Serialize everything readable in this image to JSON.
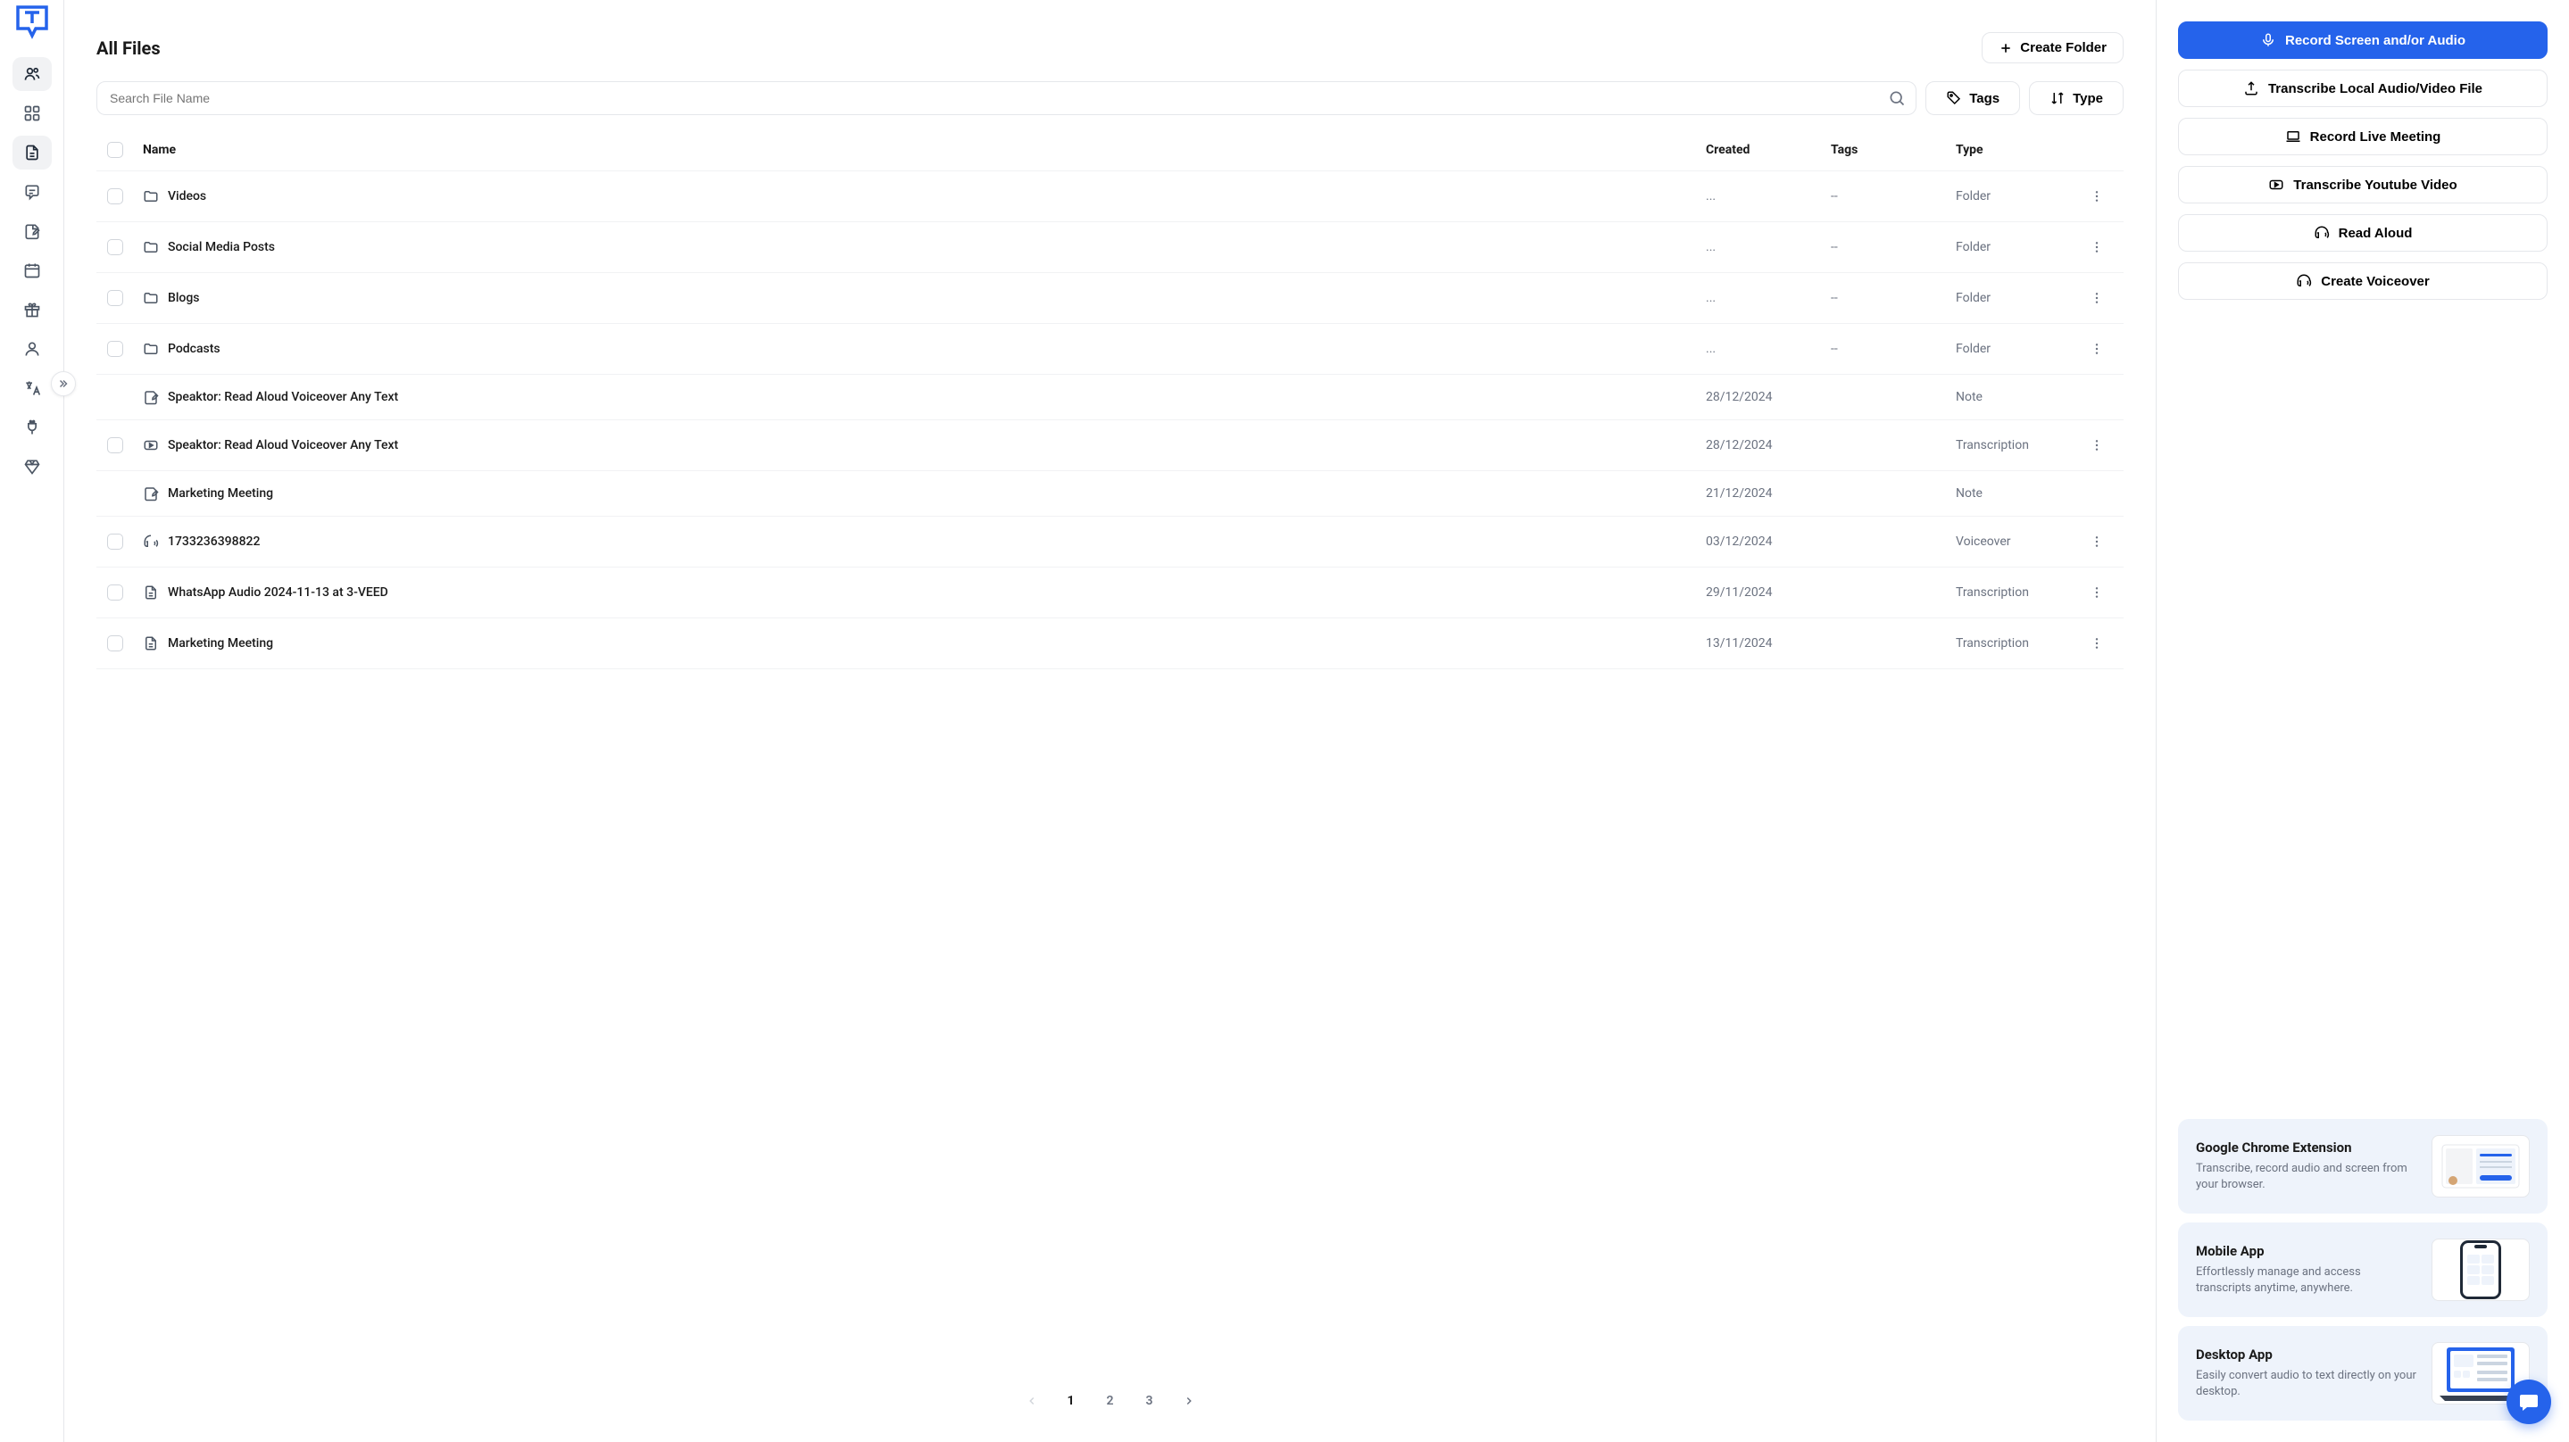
{
  "sidebar": {
    "items": [
      {
        "name": "users-icon"
      },
      {
        "name": "dashboard-icon"
      },
      {
        "name": "files-icon",
        "active": true
      },
      {
        "name": "chat-icon"
      },
      {
        "name": "notes-icon"
      },
      {
        "name": "calendar-icon"
      },
      {
        "name": "gift-icon"
      },
      {
        "name": "profile-icon"
      },
      {
        "name": "translate-icon"
      },
      {
        "name": "integrations-icon"
      },
      {
        "name": "premium-icon"
      }
    ]
  },
  "header": {
    "title": "All Files",
    "create_folder": "Create Folder"
  },
  "filters": {
    "search_placeholder": "Search File Name",
    "tags": "Tags",
    "type": "Type"
  },
  "table": {
    "columns": {
      "name": "Name",
      "created": "Created",
      "tags": "Tags",
      "type": "Type"
    },
    "rows": [
      {
        "icon": "folder",
        "name": "Videos",
        "created": "...",
        "tags": "--",
        "type": "Folder",
        "checkable": true,
        "more": true
      },
      {
        "icon": "folder",
        "name": "Social Media Posts",
        "created": "...",
        "tags": "--",
        "type": "Folder",
        "checkable": true,
        "more": true
      },
      {
        "icon": "folder",
        "name": "Blogs",
        "created": "...",
        "tags": "--",
        "type": "Folder",
        "checkable": true,
        "more": true
      },
      {
        "icon": "folder",
        "name": "Podcasts",
        "created": "...",
        "tags": "--",
        "type": "Folder",
        "checkable": true,
        "more": true
      },
      {
        "icon": "note",
        "name": "Speaktor: Read Aloud Voiceover Any Text",
        "created": "28/12/2024",
        "tags": "",
        "type": "Note",
        "checkable": false,
        "more": false
      },
      {
        "icon": "video",
        "name": "Speaktor: Read Aloud Voiceover Any Text",
        "created": "28/12/2024",
        "tags": "",
        "type": "Transcription",
        "checkable": true,
        "more": true
      },
      {
        "icon": "note",
        "name": "Marketing Meeting",
        "created": "21/12/2024",
        "tags": "",
        "type": "Note",
        "checkable": false,
        "more": false
      },
      {
        "icon": "voice",
        "name": "1733236398822",
        "created": "03/12/2024",
        "tags": "",
        "type": "Voiceover",
        "checkable": true,
        "more": true
      },
      {
        "icon": "doc",
        "name": "WhatsApp Audio 2024-11-13 at 3-VEED",
        "created": "29/11/2024",
        "tags": "",
        "type": "Transcription",
        "checkable": true,
        "more": true
      },
      {
        "icon": "doc",
        "name": "Marketing Meeting",
        "created": "13/11/2024",
        "tags": "",
        "type": "Transcription",
        "checkable": true,
        "more": true
      }
    ]
  },
  "pagination": {
    "pages": [
      "1",
      "2",
      "3"
    ],
    "active": "1"
  },
  "actions": {
    "record_screen": "Record Screen and/or Audio",
    "transcribe_local": "Transcribe Local Audio/Video File",
    "record_meeting": "Record Live Meeting",
    "transcribe_youtube": "Transcribe Youtube Video",
    "read_aloud": "Read Aloud",
    "create_voiceover": "Create Voiceover"
  },
  "promos": [
    {
      "title": "Google Chrome Extension",
      "desc": "Transcribe, record audio and screen from your browser."
    },
    {
      "title": "Mobile App",
      "desc": "Effortlessly manage and access transcripts anytime, anywhere."
    },
    {
      "title": "Desktop App",
      "desc": "Easily convert audio to text directly on your desktop."
    }
  ]
}
